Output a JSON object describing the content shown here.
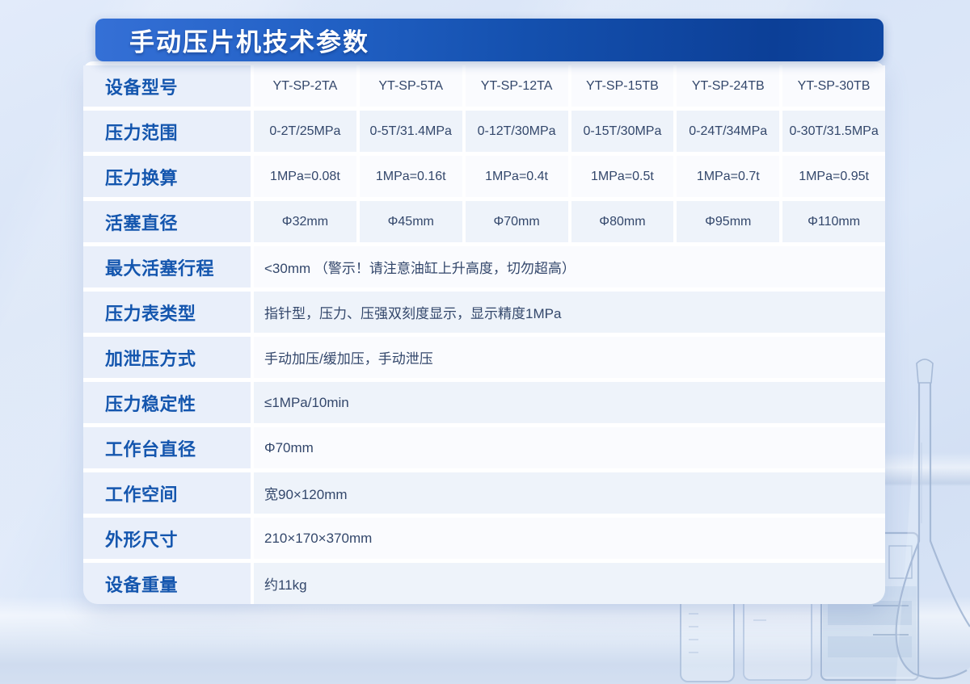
{
  "banner": {
    "title": "手动压片机技术参数",
    "gradient_start": "#3570d6",
    "gradient_end": "#0c3f97",
    "text_color": "#ffffff"
  },
  "colors": {
    "page_background": "#d8e4f7",
    "label_text": "#1456ae",
    "label_cell_bg": "#e9effa",
    "value_text": "#33476b",
    "stripe_bg": "#eef3fa",
    "card_bg": "#ffffff"
  },
  "table": {
    "rows": [
      {
        "label": "设备型号",
        "values": [
          "YT-SP-2TA",
          "YT-SP-5TA",
          "YT-SP-12TA",
          "YT-SP-15TB",
          "YT-SP-24TB",
          "YT-SP-30TB"
        ]
      },
      {
        "label": "压力范围",
        "values": [
          "0-2T/25MPa",
          "0-5T/31.4MPa",
          "0-12T/30MPa",
          "0-15T/30MPa",
          "0-24T/34MPa",
          "0-30T/31.5MPa"
        ]
      },
      {
        "label": "压力换算",
        "values": [
          "1MPa=0.08t",
          "1MPa=0.16t",
          "1MPa=0.4t",
          "1MPa=0.5t",
          "1MPa=0.7t",
          "1MPa=0.95t"
        ]
      },
      {
        "label": "活塞直径",
        "values": [
          "Φ32mm",
          "Φ45mm",
          "Φ70mm",
          "Φ80mm",
          "Φ95mm",
          "Φ110mm"
        ]
      },
      {
        "label": "最大活塞行程",
        "value": "<30mm （警示！请注意油缸上升高度，切勿超高）"
      },
      {
        "label": "压力表类型",
        "value": "指针型，压力、压强双刻度显示，显示精度1MPa"
      },
      {
        "label": "加泄压方式",
        "value": "手动加压/缓加压，手动泄压"
      },
      {
        "label": "压力稳定性",
        "value": "≤1MPa/10min"
      },
      {
        "label": "工作台直径",
        "value": "Φ70mm"
      },
      {
        "label": "工作空间",
        "value": "宽90×120mm"
      },
      {
        "label": "外形尺寸",
        "value": "210×170×370mm"
      },
      {
        "label": "设备重量",
        "value": "约11kg"
      }
    ]
  },
  "decor": {
    "glassware_icons": [
      "square-bottle-icon",
      "beaker-icon",
      "beaker-with-liquid-icon",
      "volumetric-flask-icon"
    ]
  }
}
